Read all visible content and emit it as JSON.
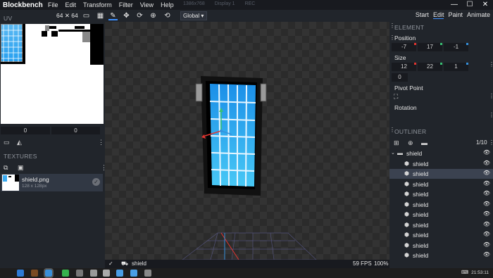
{
  "app": {
    "title": "Blockbench"
  },
  "menu": [
    "File",
    "Edit",
    "Transform",
    "Filter",
    "View",
    "Help"
  ],
  "background_windows": [
    "1386x768",
    "Display 1",
    "REC"
  ],
  "window_controls": {
    "minimize": "—",
    "maximize": "☐",
    "close": "✕"
  },
  "toolbar": {
    "texture_size": "64 ✕ 64",
    "transform_space": "Global",
    "modes": [
      "Start",
      "Edit",
      "Paint",
      "Animate"
    ],
    "active_mode": "Edit"
  },
  "uv": {
    "header": "UV",
    "inputs": [
      "0",
      "0"
    ]
  },
  "textures": {
    "header": "TEXTURES",
    "items": [
      {
        "name": "shield.png",
        "size": "128 x 128px"
      }
    ]
  },
  "element": {
    "header": "ELEMENT",
    "position_label": "Position",
    "position": [
      "-7",
      "17",
      "-1"
    ],
    "size_label": "Size",
    "size": [
      "12",
      "22",
      "1"
    ],
    "inflate": "0",
    "pivot_label": "Pivot Point",
    "rotation_label": "Rotation"
  },
  "outliner": {
    "header": "OUTLINER",
    "counter": "1/10",
    "group": "shield",
    "items": [
      "shield",
      "shield",
      "shield",
      "shield",
      "shield",
      "shield",
      "shield",
      "shield",
      "shield",
      "shield"
    ],
    "selected_index": 1
  },
  "status": {
    "model_name": "shield",
    "fps": "59 FPS",
    "zoom": "100%"
  },
  "taskbar": {
    "time": "21:53:11"
  },
  "colors": {
    "accent": "#3e90ff",
    "panel": "#21252b",
    "x_axis": "#e3342f",
    "y_axis": "#38c172",
    "z_axis": "#3490dc"
  }
}
